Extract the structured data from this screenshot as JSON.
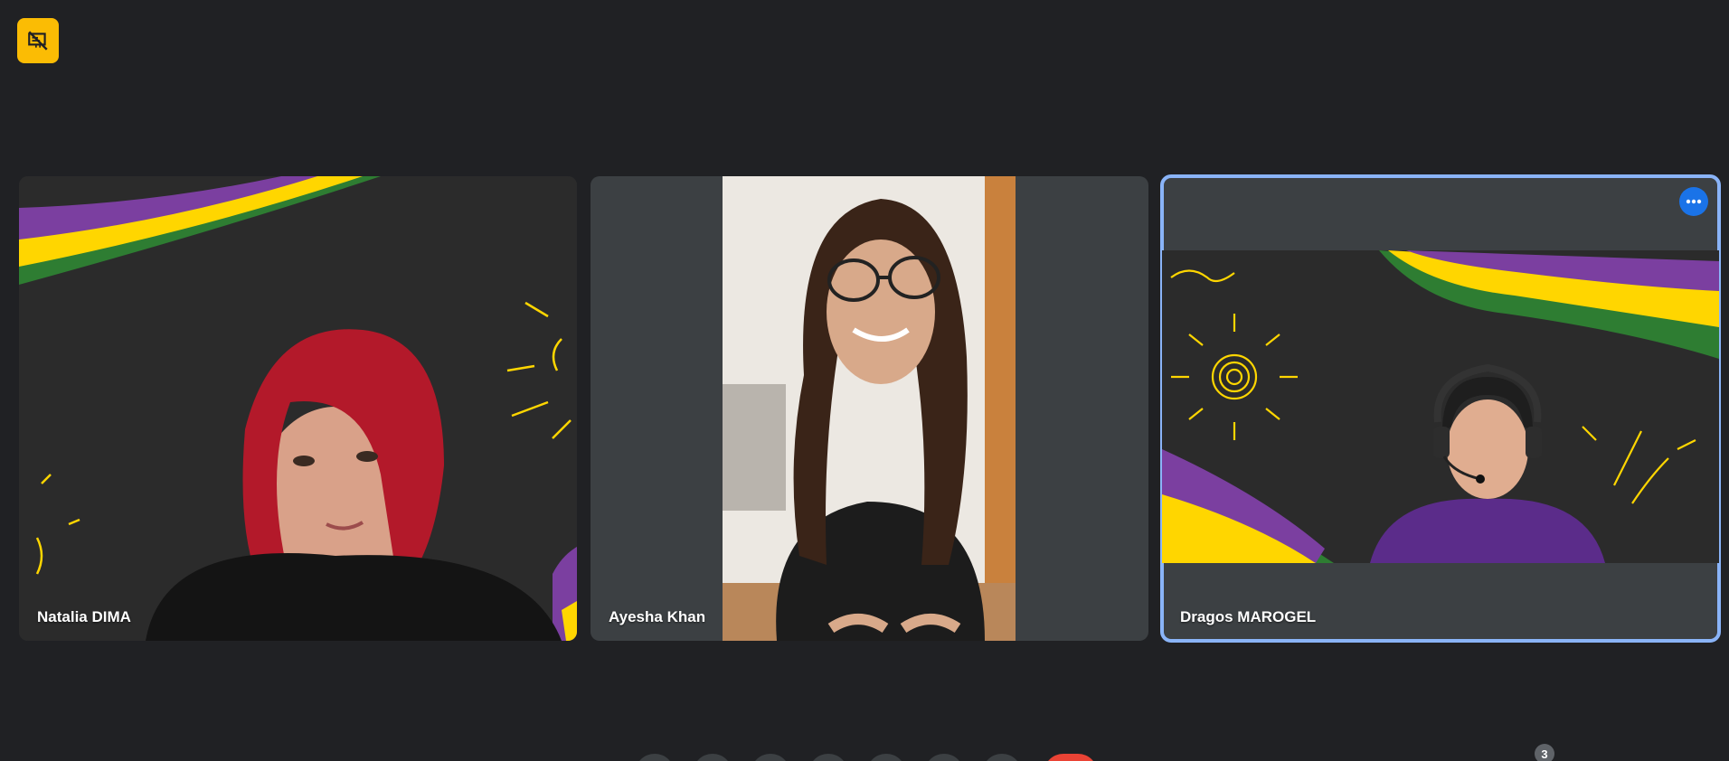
{
  "participants": [
    {
      "name": "Natalia DIMA"
    },
    {
      "name": "Ayesha Khan"
    },
    {
      "name": "Dragos MAROGEL"
    }
  ],
  "participant_count": "3",
  "colors": {
    "background": "#202124",
    "tile": "#3c4043",
    "active_outline": "#8ab4f8",
    "badge": "#fbbc04",
    "more_button": "#1a73e8",
    "leave_button": "#ea4335"
  },
  "icons": {
    "top_badge": "presentation-off-icon",
    "more_options": "more-horizontal-icon"
  }
}
